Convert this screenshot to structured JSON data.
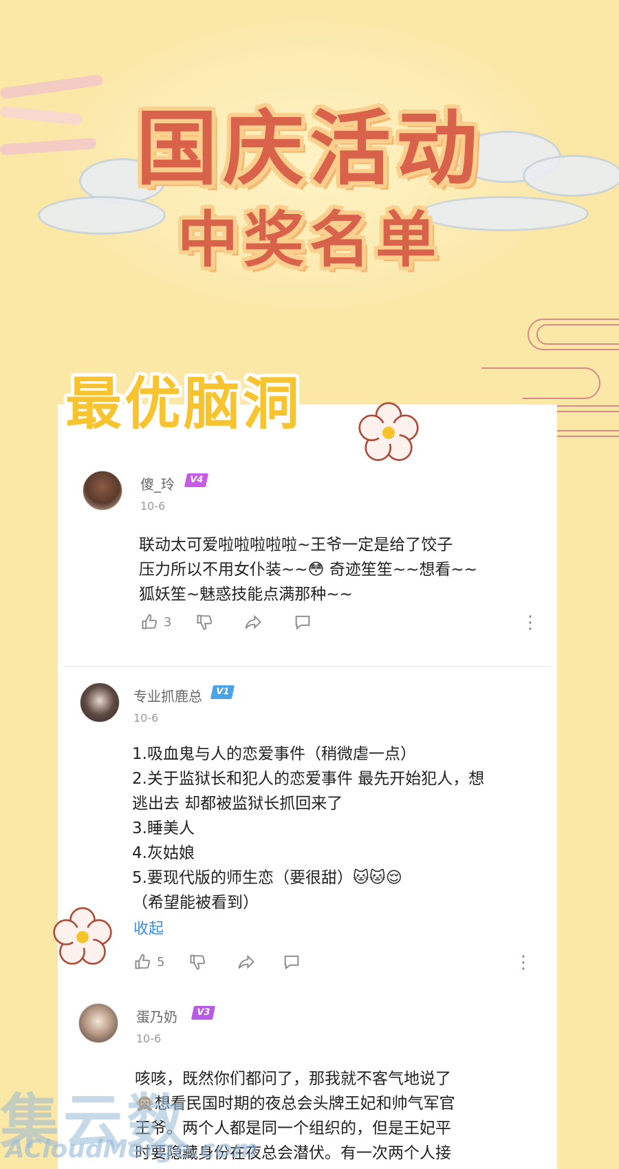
{
  "banner": {
    "title": "国庆活动",
    "subtitle": "中奖名单"
  },
  "section": {
    "title": "最优脑洞"
  },
  "colors": {
    "background": "#fbe7a6",
    "title_red": "#d9624b",
    "section_yellow": "#f7c42f",
    "link_blue": "#3a8ee6",
    "badge_v4": "#c65be8",
    "badge_v1": "#4aa3e8",
    "badge_v3": "#b65be8"
  },
  "comments": [
    {
      "username": "傻_玲",
      "level": "V4",
      "date": "10-6",
      "lines": [
        "联动太可爱啦啦啦啦啦~王爷一定是给了饺子",
        "压力所以不用女仆装~~😳 奇迹笙笙~~想看~~",
        "狐妖笙~魅惑技能点满那种~~"
      ],
      "likes": "3"
    },
    {
      "username": "专业抓鹿总",
      "level": "V1",
      "date": "10-6",
      "lines": [
        "1.吸血鬼与人的恋爱事件（稍微虐一点）",
        "2.关于监狱长和犯人的恋爱事件  最先开始犯人，想",
        "逃出去 却都被监狱长抓回来了",
        "3.睡美人",
        "4.灰姑娘",
        "5.要现代版的师生恋（要很甜）🐱🐱😌",
        "（希望能被看到）"
      ],
      "collapse_label": "收起",
      "likes": "5"
    },
    {
      "username": "蛋乃奶",
      "level": "V3",
      "date": "10-6",
      "lines": [
        "咳咳，既然你们都问了，那我就不客气地说了",
        "🙊想看民国时期的夜总会头牌王妃和帅气军官",
        "王爷。两个人都是同一个组织的，但是王妃平",
        "时要隐藏身份在夜总会潜伏。有一次两个人接"
      ]
    }
  ],
  "watermark": {
    "main": "集云数",
    "sub": "ACloudMerge.com"
  },
  "icons": [
    "thumb-up-icon",
    "thumb-down-icon",
    "share-icon",
    "comment-icon",
    "more-icon",
    "flower-icon"
  ]
}
